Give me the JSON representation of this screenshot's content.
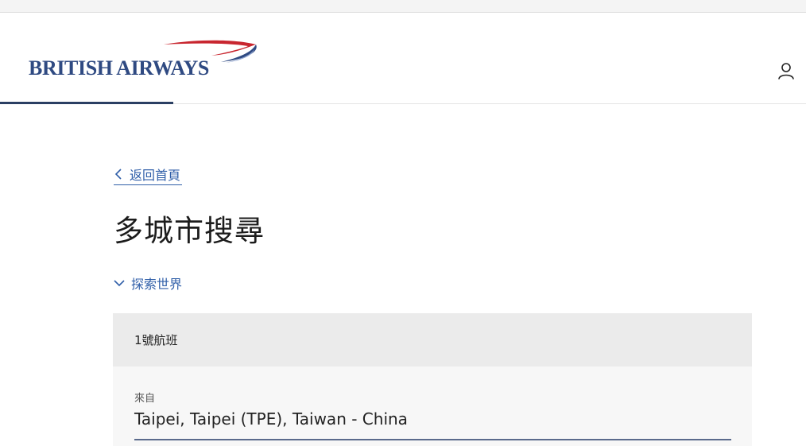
{
  "brand": {
    "name": "BRITISH AIRWAYS",
    "primary_color": "#2f4a82",
    "swoosh_red": "#c8262f",
    "link_color": "#2f5ea8"
  },
  "header": {
    "account_icon": "user-icon"
  },
  "nav": {
    "back_label": "返回首頁",
    "back_icon": "chevron-left-icon"
  },
  "page": {
    "title": "多城市搜尋"
  },
  "explore": {
    "label": "探索世界",
    "icon": "chevron-down-icon"
  },
  "flights": [
    {
      "header": "1號航班",
      "from_label": "來自",
      "from_value": "Taipei, Taipei (TPE), Taiwan - China"
    }
  ]
}
